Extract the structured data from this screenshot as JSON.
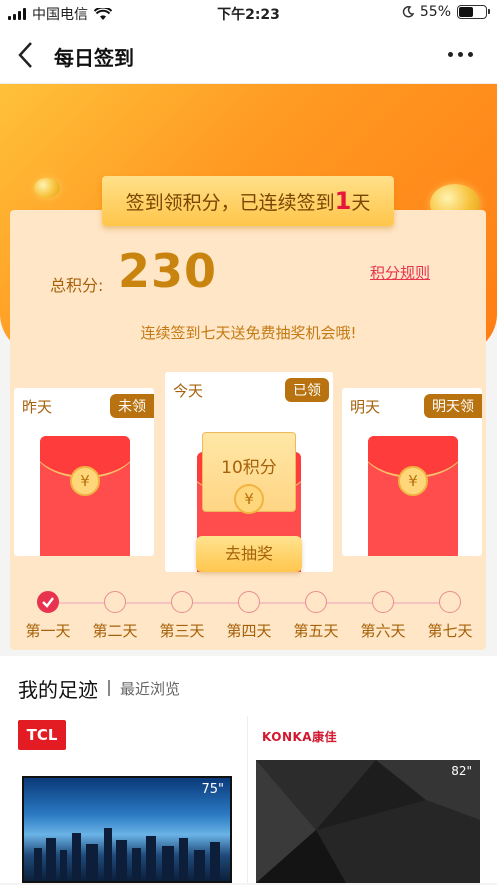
{
  "status": {
    "carrier": "中国电信",
    "time": "下午2:23",
    "battery": "55%",
    "battery_level": 0.55
  },
  "nav": {
    "title": "每日签到"
  },
  "banner": {
    "prefix": "签到领积分，已连续签到",
    "days": "1",
    "suffix": "天"
  },
  "points": {
    "label": "总积分:",
    "value": "230",
    "rules_link": "积分规则"
  },
  "hint": "连续签到七天送免费抽奖机会哦!",
  "cards": {
    "yesterday": {
      "label": "昨天",
      "tag": "未领"
    },
    "today": {
      "label": "今天",
      "tag": "已领",
      "reward": "10积分",
      "button": "去抽奖"
    },
    "tomorrow": {
      "label": "明天",
      "tag": "明天领"
    }
  },
  "currency": "¥",
  "progress": {
    "days": [
      "第一天",
      "第二天",
      "第三天",
      "第四天",
      "第五天",
      "第六天",
      "第七天"
    ],
    "checked_count": 1
  },
  "footprint": {
    "title": "我的足迹",
    "subtitle": "最近浏览"
  },
  "products": [
    {
      "brand": "TCL",
      "size": "75\""
    },
    {
      "brand": "KONKA康佳",
      "size": "82\""
    }
  ],
  "colors": {
    "accent": "#e8334f",
    "orange": "#ff8a1c",
    "gold": "#c8840f"
  }
}
